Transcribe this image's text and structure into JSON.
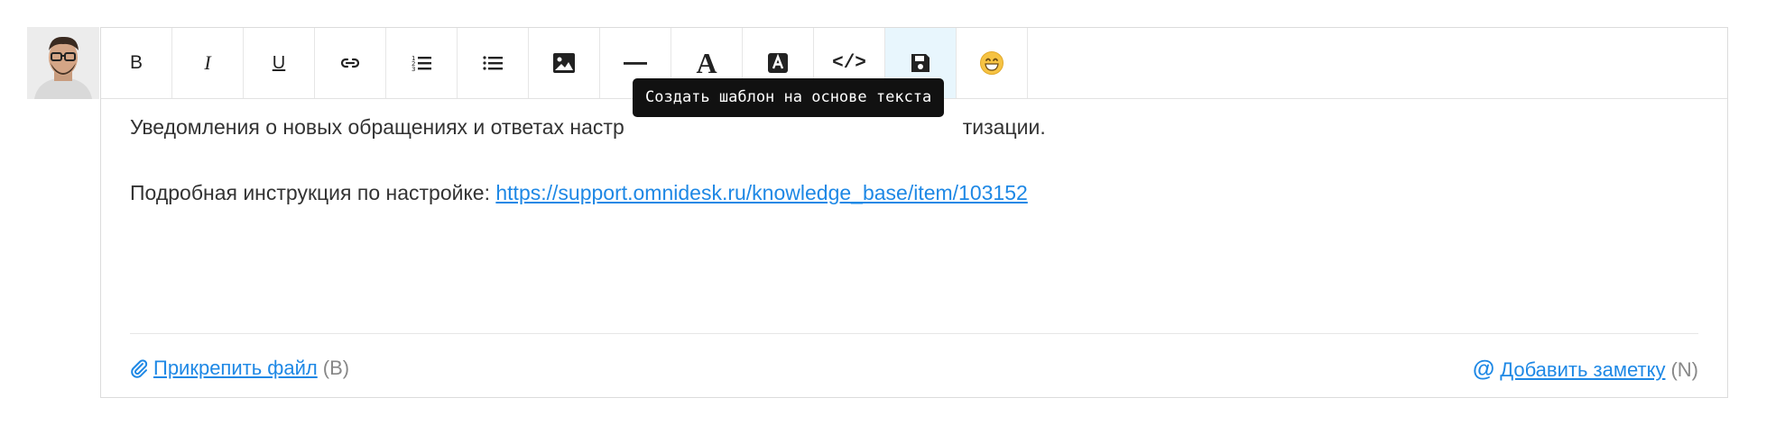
{
  "toolbar": {
    "bold_label": "B",
    "italic_label": "I",
    "underline_label": "U",
    "font_color_label": "A",
    "code_label": "</>",
    "icons": [
      "bold",
      "italic",
      "underline",
      "link-icon",
      "ordered-list-icon",
      "unordered-list-icon",
      "image-icon",
      "horizontal-rule-icon",
      "font-color-icon",
      "highlight-icon",
      "code-icon",
      "save-template-icon",
      "emoji-icon"
    ]
  },
  "tooltip": {
    "text": "Создать шаблон на основе текста"
  },
  "content": {
    "line1": "Уведомления о новых обращениях и ответах настр",
    "line1_end": "тизации.",
    "line2_prefix": "Подробная инструкция по настройке: ",
    "line2_link": "https://support.omnidesk.ru/knowledge_base/item/103152"
  },
  "footer": {
    "attach_label": "Прикрепить файл",
    "attach_hint": "(B)",
    "note_label": "Добавить заметку",
    "note_hint": "(N)",
    "note_icon": "@"
  },
  "colors": {
    "accent": "#1e88e5",
    "active_button_bg": "#e8f6fd",
    "tooltip_bg": "#111111"
  }
}
